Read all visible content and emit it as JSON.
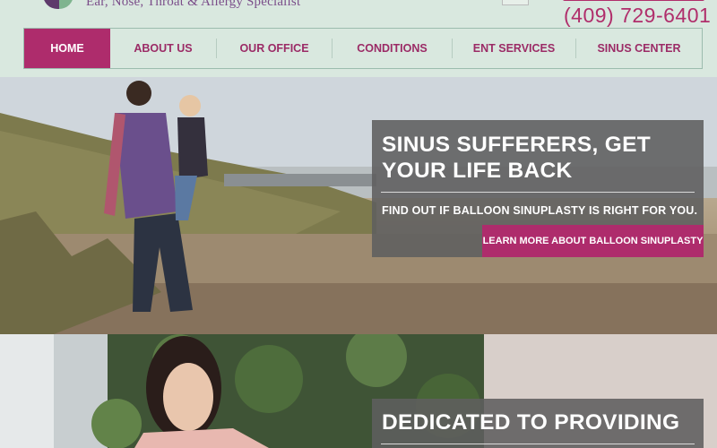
{
  "header": {
    "tagline": "Ear, Nose, Throat & Allergy Specialist",
    "phone": "(409) 729-6401"
  },
  "nav": {
    "items": [
      "HOME",
      "ABOUT US",
      "OUR OFFICE",
      "CONDITIONS",
      "ENT SERVICES",
      "SINUS CENTER"
    ],
    "active": "HOME"
  },
  "hero1": {
    "title_line1": "SINUS SUFFERERS, GET",
    "title_line2": "YOUR LIFE BACK",
    "subtitle": "FIND OUT IF BALLOON SINUPLASTY IS RIGHT FOR YOU.",
    "cta": "LEARN MORE ABOUT BALLOON SINUPLASTY"
  },
  "hero2": {
    "title": "DEDICATED TO PROVIDING"
  },
  "colors": {
    "header_bg": "#d9e8df",
    "accent": "#ae2c6c",
    "panel": "#5f5f5f"
  }
}
